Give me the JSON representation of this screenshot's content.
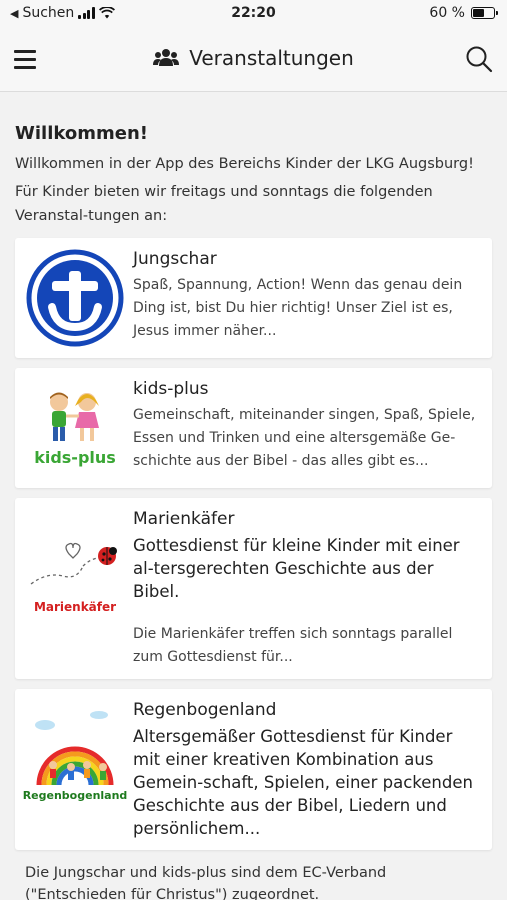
{
  "status": {
    "carrier": "Suchen",
    "time": "22:20",
    "battery_pct": "60 %",
    "battery_level": 0.6
  },
  "nav": {
    "title": "Veranstaltungen"
  },
  "welcome": {
    "title": "Willkommen!",
    "line1": "Willkommen in der App des Bereichs Kinder der LKG Augsburg!",
    "line2": "Für Kinder bieten wir freitags und sonntags die folgenden Veranstal-tungen an:"
  },
  "cards": [
    {
      "title": "Jungschar",
      "subtitle": "",
      "description": "Spaß, Spannung, Action! Wenn das genau dein Ding ist, bist Du hier richtig! Unser Ziel ist es, Jesus immer näher..."
    },
    {
      "title": "kids-plus",
      "subtitle": "",
      "description": "Gemeinschaft, miteinander singen, Spaß, Spiele, Essen und Trinken und eine altersgemäße Ge-schichte aus der Bibel - das alles gibt es...",
      "logo_text": "kids-plus"
    },
    {
      "title": "Marienkäfer",
      "subtitle": "Gottesdienst für kleine Kinder mit einer al-tersgerechten Geschichte aus der Bibel.",
      "description": "Die Marienkäfer treffen sich sonntags parallel zum Gottesdienst für...",
      "logo_text": "Marienkäfer"
    },
    {
      "title": "Regenbogenland",
      "subtitle": "Altersgemäßer Gottesdienst für Kinder mit einer kreativen Kombination aus Gemein-schaft, Spielen, einer packenden Geschichte aus der Bibel, Liedern und persönlichem...",
      "description": "",
      "logo_text": "Regenbogenland"
    }
  ],
  "footer": {
    "text": "Die Jungschar und kids-plus sind dem EC-Verband (\"Entschieden für Christus\") zugeordnet."
  },
  "colors": {
    "jungschar_blue": "#1446b8",
    "kids_green": "#3aa635",
    "marienkaefer_red": "#d42020",
    "regenbogen_green": "#1e7a1e"
  }
}
